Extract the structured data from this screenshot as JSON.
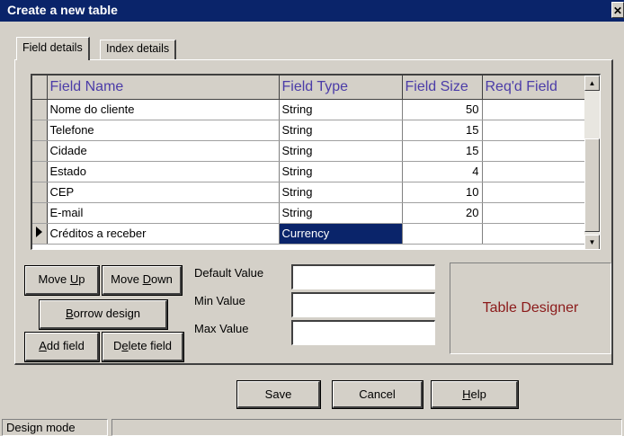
{
  "window": {
    "title": "Create a new table",
    "close_glyph": "✕"
  },
  "tabs": [
    {
      "label": "Field details",
      "active": true
    },
    {
      "label": "Index details",
      "active": false
    }
  ],
  "grid": {
    "columns": [
      "Field Name",
      "Field Type",
      "Field Size",
      "Req'd Field"
    ],
    "rows": [
      {
        "name": "Nome do cliente",
        "type": "String",
        "size": "50",
        "required": ""
      },
      {
        "name": "Telefone",
        "type": "String",
        "size": "15",
        "required": ""
      },
      {
        "name": "Cidade",
        "type": "String",
        "size": "15",
        "required": ""
      },
      {
        "name": "Estado",
        "type": "String",
        "size": "4",
        "required": ""
      },
      {
        "name": "CEP",
        "type": "String",
        "size": "10",
        "required": ""
      },
      {
        "name": "E-mail",
        "type": "String",
        "size": "20",
        "required": ""
      },
      {
        "name": "Créditos a receber",
        "type": "Currency",
        "size": "",
        "required": "",
        "current": true
      }
    ],
    "scroll_up_glyph": "▲",
    "scroll_down_glyph": "▼"
  },
  "buttons": {
    "move_up": {
      "pre": "Move ",
      "key": "U",
      "post": "p"
    },
    "move_down": {
      "pre": "Move ",
      "key": "D",
      "post": "own"
    },
    "borrow": {
      "pre": "",
      "key": "B",
      "post": "orrow design"
    },
    "add_field": {
      "pre": "",
      "key": "A",
      "post": "dd field"
    },
    "delete_field": {
      "pre": "D",
      "key": "e",
      "post": "lete field"
    },
    "save": "Save",
    "cancel": "Cancel",
    "help": {
      "pre": "",
      "key": "H",
      "post": "elp"
    }
  },
  "properties": {
    "default_label": "Default Value",
    "min_label": "Min Value",
    "max_label": "Max Value",
    "default_value": "",
    "min_value": "",
    "max_value": ""
  },
  "designer_label": "Table Designer",
  "status": {
    "mode": "Design mode"
  },
  "colors": {
    "titlebar": "#0a246a",
    "header_text": "#4b3ca8",
    "designer_text": "#8b1a1a",
    "selection": "#0a246a"
  }
}
